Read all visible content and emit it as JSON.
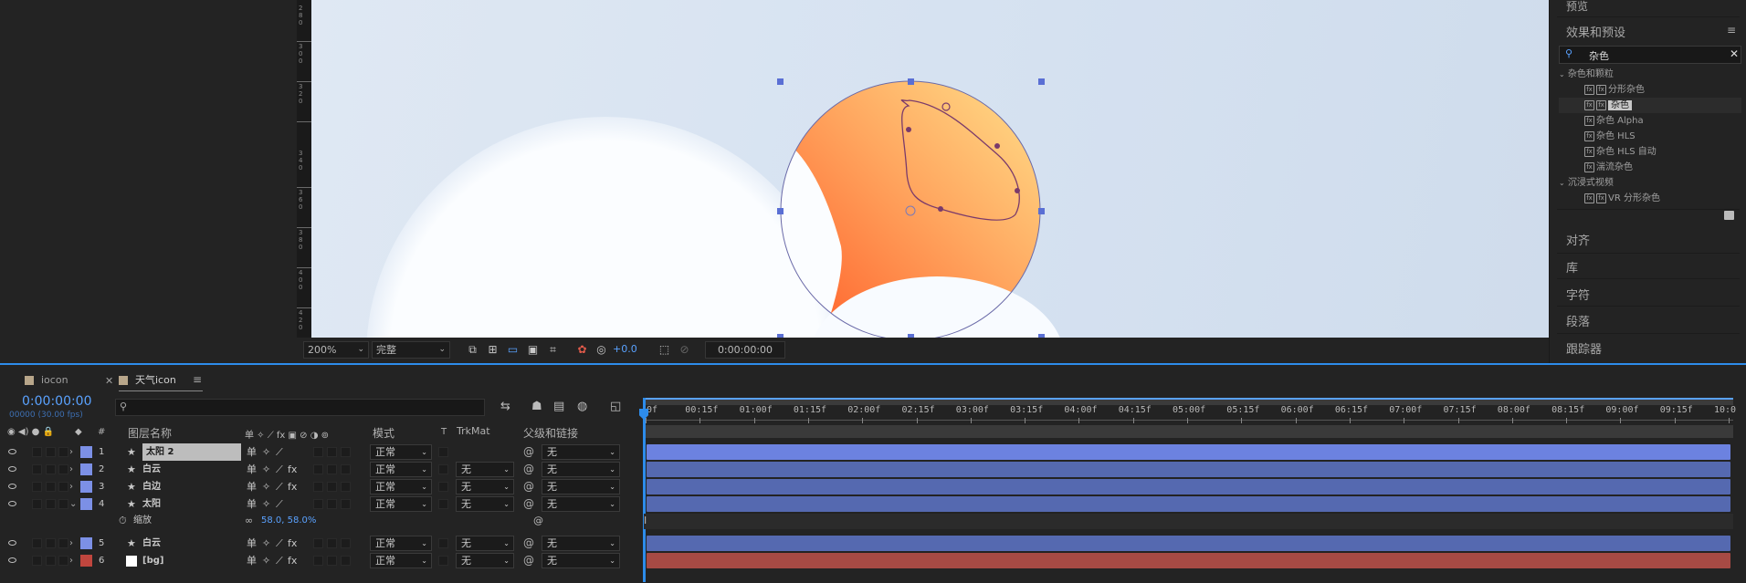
{
  "viewer": {
    "zoom": "200%",
    "resolution": "完整",
    "exposure": "+0.0",
    "timecode": "0:00:00:00",
    "ruler_labels": [
      "2",
      "8",
      "0",
      "3",
      "0",
      "0",
      "3",
      "2",
      "0",
      "3",
      "4",
      "0",
      "3",
      "6",
      "0",
      "3",
      "8",
      "0",
      "4",
      "0",
      "0",
      "4",
      "2",
      "0"
    ]
  },
  "right_panel": {
    "preview_title": "预览",
    "effects_title": "效果和预设",
    "search_value": "杂色",
    "category": "杂色和颗粒",
    "items": [
      "分形杂色",
      "杂色",
      "杂色 Alpha",
      "杂色 HLS",
      "杂色 HLS 自动",
      "湍流杂色"
    ],
    "category2": "沉浸式视频",
    "items2": [
      "VR 分形杂色"
    ],
    "panels": [
      "对齐",
      "库",
      "字符",
      "段落",
      "跟踪器"
    ]
  },
  "timeline": {
    "tabs": [
      "iocon",
      "天气icon"
    ],
    "timecode": "0:00:00:00",
    "timecode_sub": "00000 (30.00 fps)",
    "headers": {
      "num": "#",
      "name": "图层名称",
      "mode": "模式",
      "t": "T",
      "trkmat": "TrkMat",
      "parent": "父级和链接"
    },
    "layers": [
      {
        "num": "1",
        "name": "太阳 2",
        "mode": "正常",
        "trkmat": "",
        "parent": "无",
        "color": "#7c90e6",
        "bar": "#6c82e0"
      },
      {
        "num": "2",
        "name": "白云",
        "mode": "正常",
        "trkmat": "无",
        "parent": "无",
        "color": "#7c90e6",
        "bar": "#5569b0"
      },
      {
        "num": "3",
        "name": "白边",
        "mode": "正常",
        "trkmat": "无",
        "parent": "无",
        "color": "#7c90e6",
        "bar": "#5569b0"
      },
      {
        "num": "4",
        "name": "太阳",
        "mode": "正常",
        "trkmat": "无",
        "parent": "无",
        "color": "#7c90e6",
        "bar": "#5569b0"
      },
      {
        "num": "5",
        "name": "白云",
        "mode": "正常",
        "trkmat": "无",
        "parent": "无",
        "color": "#7c90e6",
        "bar": "#5569b0"
      },
      {
        "num": "6",
        "name": "[bg]",
        "mode": "正常",
        "trkmat": "无",
        "parent": "无",
        "color": "#c0463e",
        "bar": "#a64a44"
      }
    ],
    "scale_row": {
      "label": "缩放",
      "value": "58.0, 58.0%"
    },
    "ticks": [
      "0f",
      "00:15f",
      "01:00f",
      "01:15f",
      "02:00f",
      "02:15f",
      "03:00f",
      "03:15f",
      "04:00f",
      "04:15f",
      "05:00f",
      "05:15f",
      "06:00f",
      "06:15f",
      "07:00f",
      "07:15f",
      "08:00f",
      "08:15f",
      "09:00f",
      "09:15f",
      "10:0"
    ]
  }
}
